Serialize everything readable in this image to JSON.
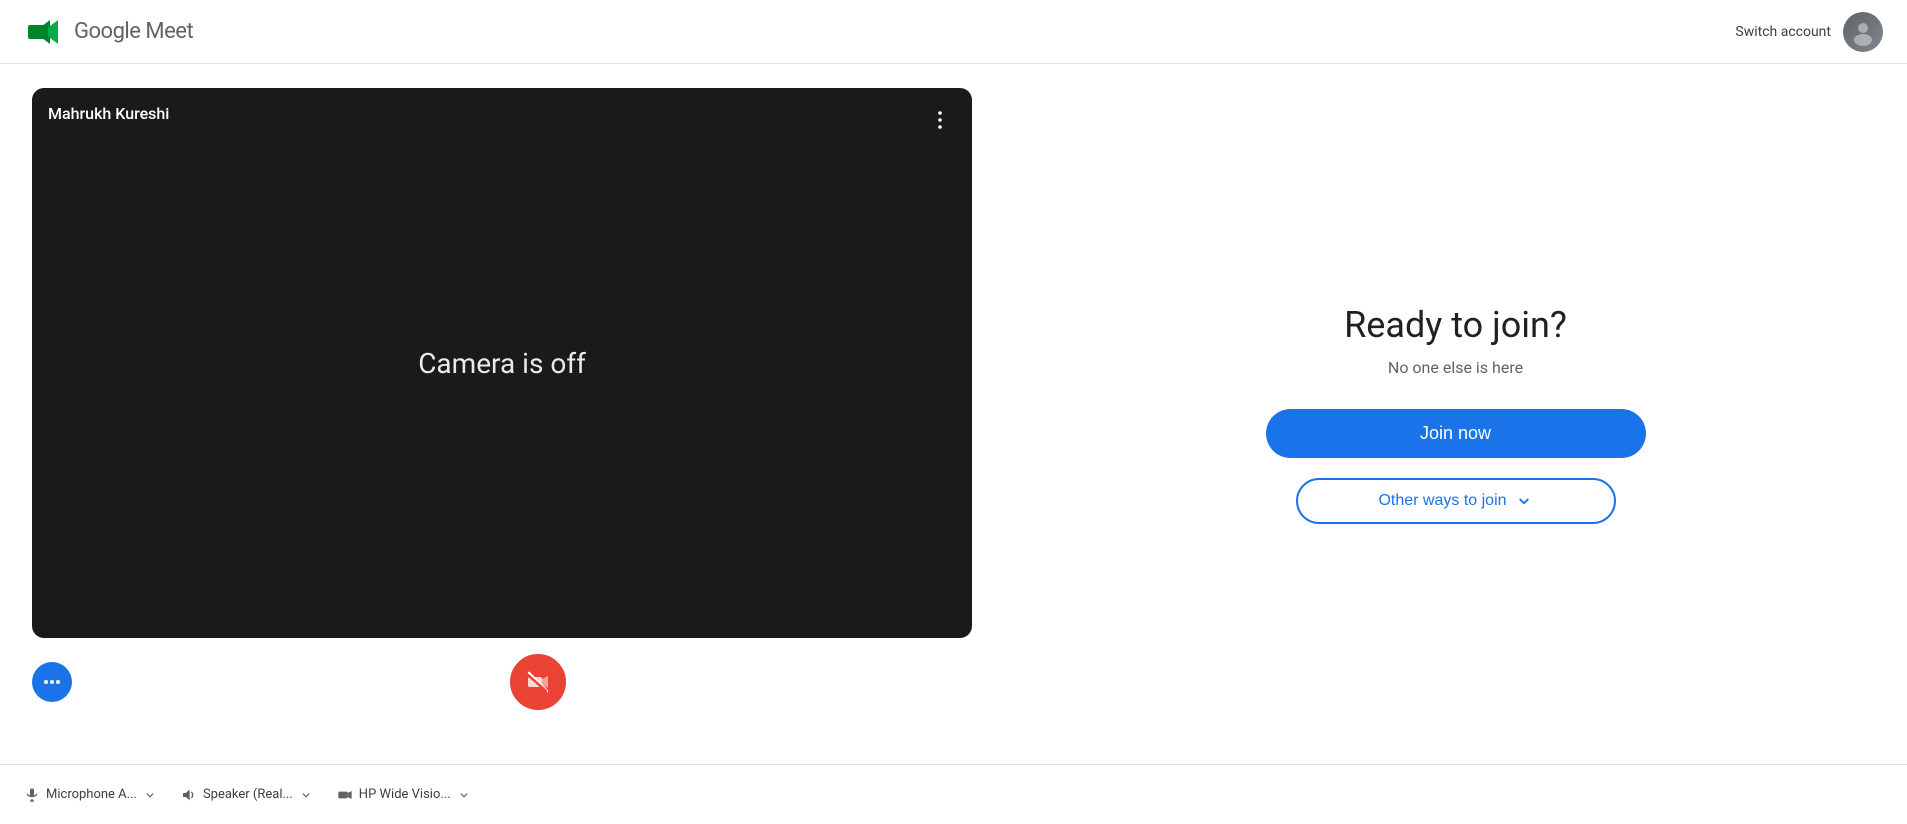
{
  "header": {
    "app_name": "Google Meet",
    "switch_account_label": "Switch account"
  },
  "video_panel": {
    "participant_name": "Mahrukh Kureshi",
    "camera_off_text": "Camera is off"
  },
  "controls": {
    "microphone_label": "Microphone",
    "camera_label": "Camera",
    "effects_label": "Effects"
  },
  "bottom_bar": {
    "microphone_device": "Microphone A...",
    "speaker_device": "Speaker (Real...",
    "camera_device": "HP Wide Visio..."
  },
  "right_panel": {
    "ready_title": "Ready to join?",
    "no_one_text": "No one else is here",
    "join_now_label": "Join now",
    "other_ways_label": "Other ways to join"
  }
}
